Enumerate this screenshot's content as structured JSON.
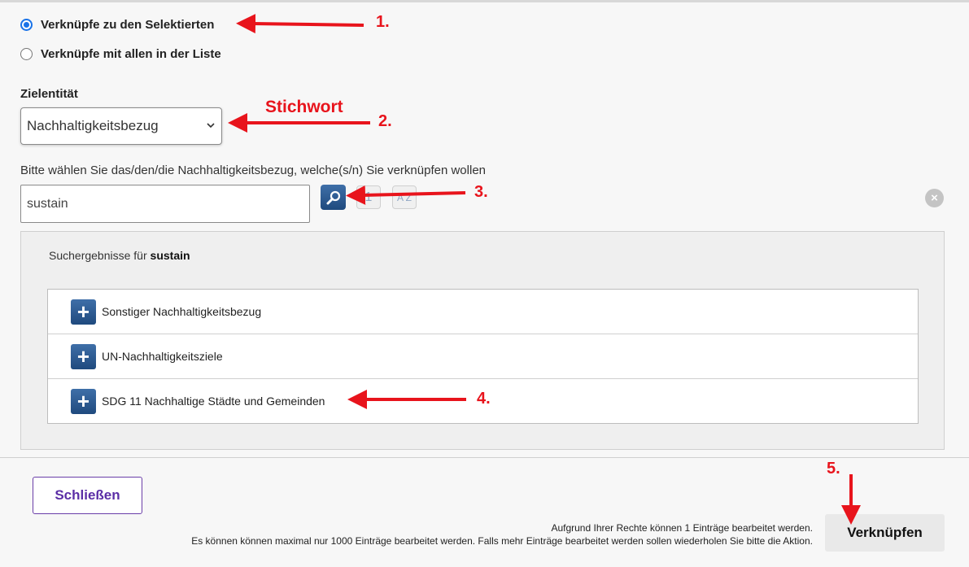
{
  "link_mode": {
    "options": [
      {
        "label": "Verknüpfe zu den Selektierten",
        "selected": true
      },
      {
        "label": "Verknüpfe mit allen in der Liste",
        "selected": false
      }
    ]
  },
  "target_entity": {
    "label": "Zielentität",
    "selected_value": "Nachhaltigkeitsbezug"
  },
  "search": {
    "hint": "Bitte wählen Sie das/den/die Nachhaltigkeitsbezug, welche(s/n) Sie verknüpfen wollen",
    "value": "sustain",
    "sort_asc_glyph": "1",
    "sort_alpha_glyph": "A Z"
  },
  "results": {
    "heading_prefix": "Suchergebnisse für",
    "heading_term": "sustain",
    "items": [
      {
        "label": "Sonstiger Nachhaltigkeitsbezug"
      },
      {
        "label": "UN-Nachhaltigkeitsziele"
      },
      {
        "label": "SDG 11 Nachhaltige Städte und Gemeinden"
      }
    ]
  },
  "footer": {
    "close_label": "Schließen",
    "info_line1": "Aufgrund Ihrer Rechte können 1 Einträge bearbeitet werden.",
    "info_line2": "Es können können maximal nur 1000 Einträge bearbeitet werden. Falls mehr Einträge bearbeitet werden sollen wiederholen Sie bitte die Aktion.",
    "link_label": "Verknüpfen"
  },
  "annotations": {
    "step1": "1.",
    "step2": "2.",
    "step2_word": "Stichwort",
    "step3": "3.",
    "step4": "4.",
    "step5": "5.",
    "color": "#e8141c"
  },
  "icons": {
    "search": "magnifier-icon",
    "plus": "plus-icon",
    "clear": "clear-icon",
    "select": "chevron-down-icon"
  }
}
